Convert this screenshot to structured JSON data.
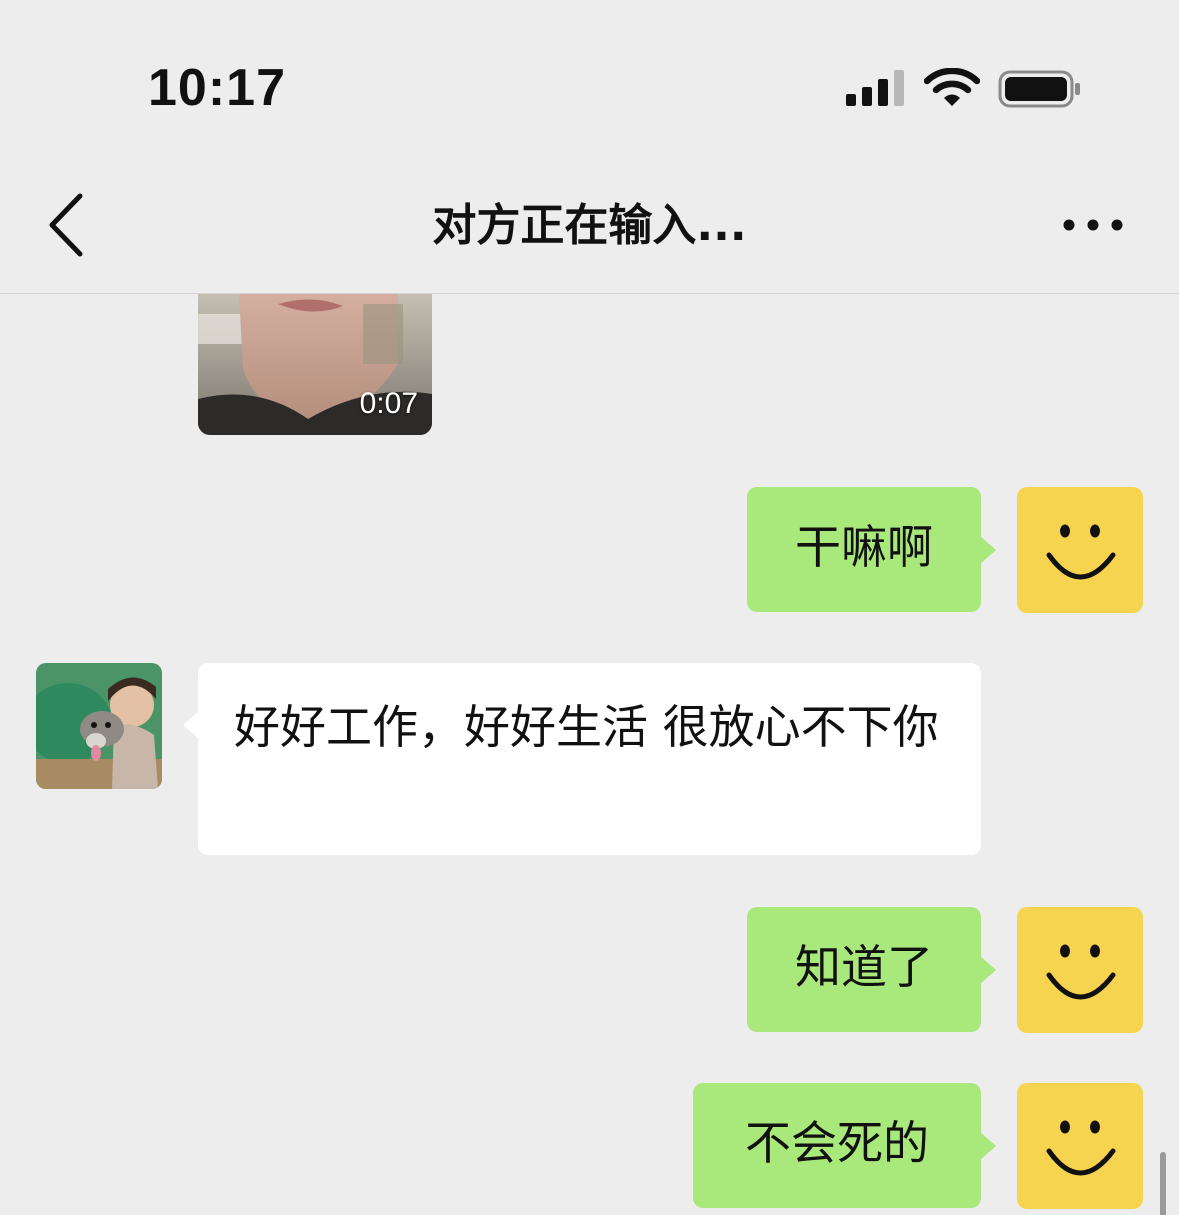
{
  "status_bar": {
    "time": "10:17",
    "icons": [
      "cellular-signal-icon",
      "wifi-icon",
      "battery-icon"
    ]
  },
  "nav": {
    "back_icon": "chevron-left-icon",
    "title": "对方正在输入...",
    "more_icon": "ellipsis-icon"
  },
  "messages": [
    {
      "type": "video",
      "sender": "contact",
      "duration": "0:07"
    },
    {
      "type": "text",
      "sender": "me",
      "text": "干嘛啊"
    },
    {
      "type": "text",
      "sender": "contact",
      "text": "好好工作，好好生活 很放心不下你"
    },
    {
      "type": "text",
      "sender": "me",
      "text": "知道了"
    },
    {
      "type": "text",
      "sender": "me",
      "text": "不会死的"
    }
  ],
  "colors": {
    "background": "#ededed",
    "outgoing_bubble": "#a9e87a",
    "incoming_bubble": "#ffffff",
    "smiley_avatar": "#f7d450"
  }
}
